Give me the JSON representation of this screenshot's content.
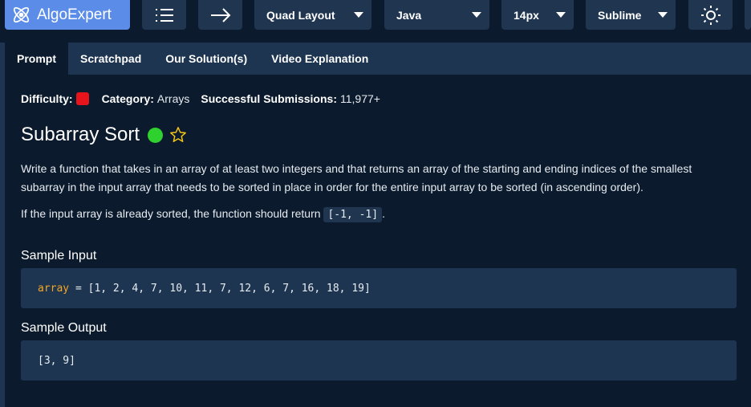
{
  "toolbar": {
    "logo_text": "AlgoExpert",
    "layout_select": "Quad Layout",
    "language_select": "Java",
    "font_size_select": "14px",
    "keymap_select": "Sublime"
  },
  "tabs": [
    {
      "label": "Prompt",
      "active": true
    },
    {
      "label": "Scratchpad",
      "active": false
    },
    {
      "label": "Our Solution(s)",
      "active": false
    },
    {
      "label": "Video Explanation",
      "active": false
    }
  ],
  "meta": {
    "difficulty_label": "Difficulty:",
    "difficulty_color": "#e8141c",
    "category_label": "Category:",
    "category_value": "Arrays",
    "submissions_label": "Successful Submissions:",
    "submissions_value": "11,977+"
  },
  "problem": {
    "title": "Subarray Sort",
    "status_color": "#2fd12f",
    "description_1": "Write a function that takes in an array of at least two integers and that returns an array of the starting and ending indices of the smallest subarray in the input array that needs to be sorted in place in order for the entire input array to be sorted (in ascending order).",
    "description_2_before": "If the input array is already sorted, the function should return ",
    "description_2_code": "[-1, -1]",
    "description_2_after": "."
  },
  "sample_input": {
    "label": "Sample Input",
    "var_name": "array",
    "value": " = [1, 2, 4, 7, 10, 11, 7, 12, 6, 7, 16, 18, 19]"
  },
  "sample_output": {
    "label": "Sample Output",
    "value": "[3, 9]"
  }
}
